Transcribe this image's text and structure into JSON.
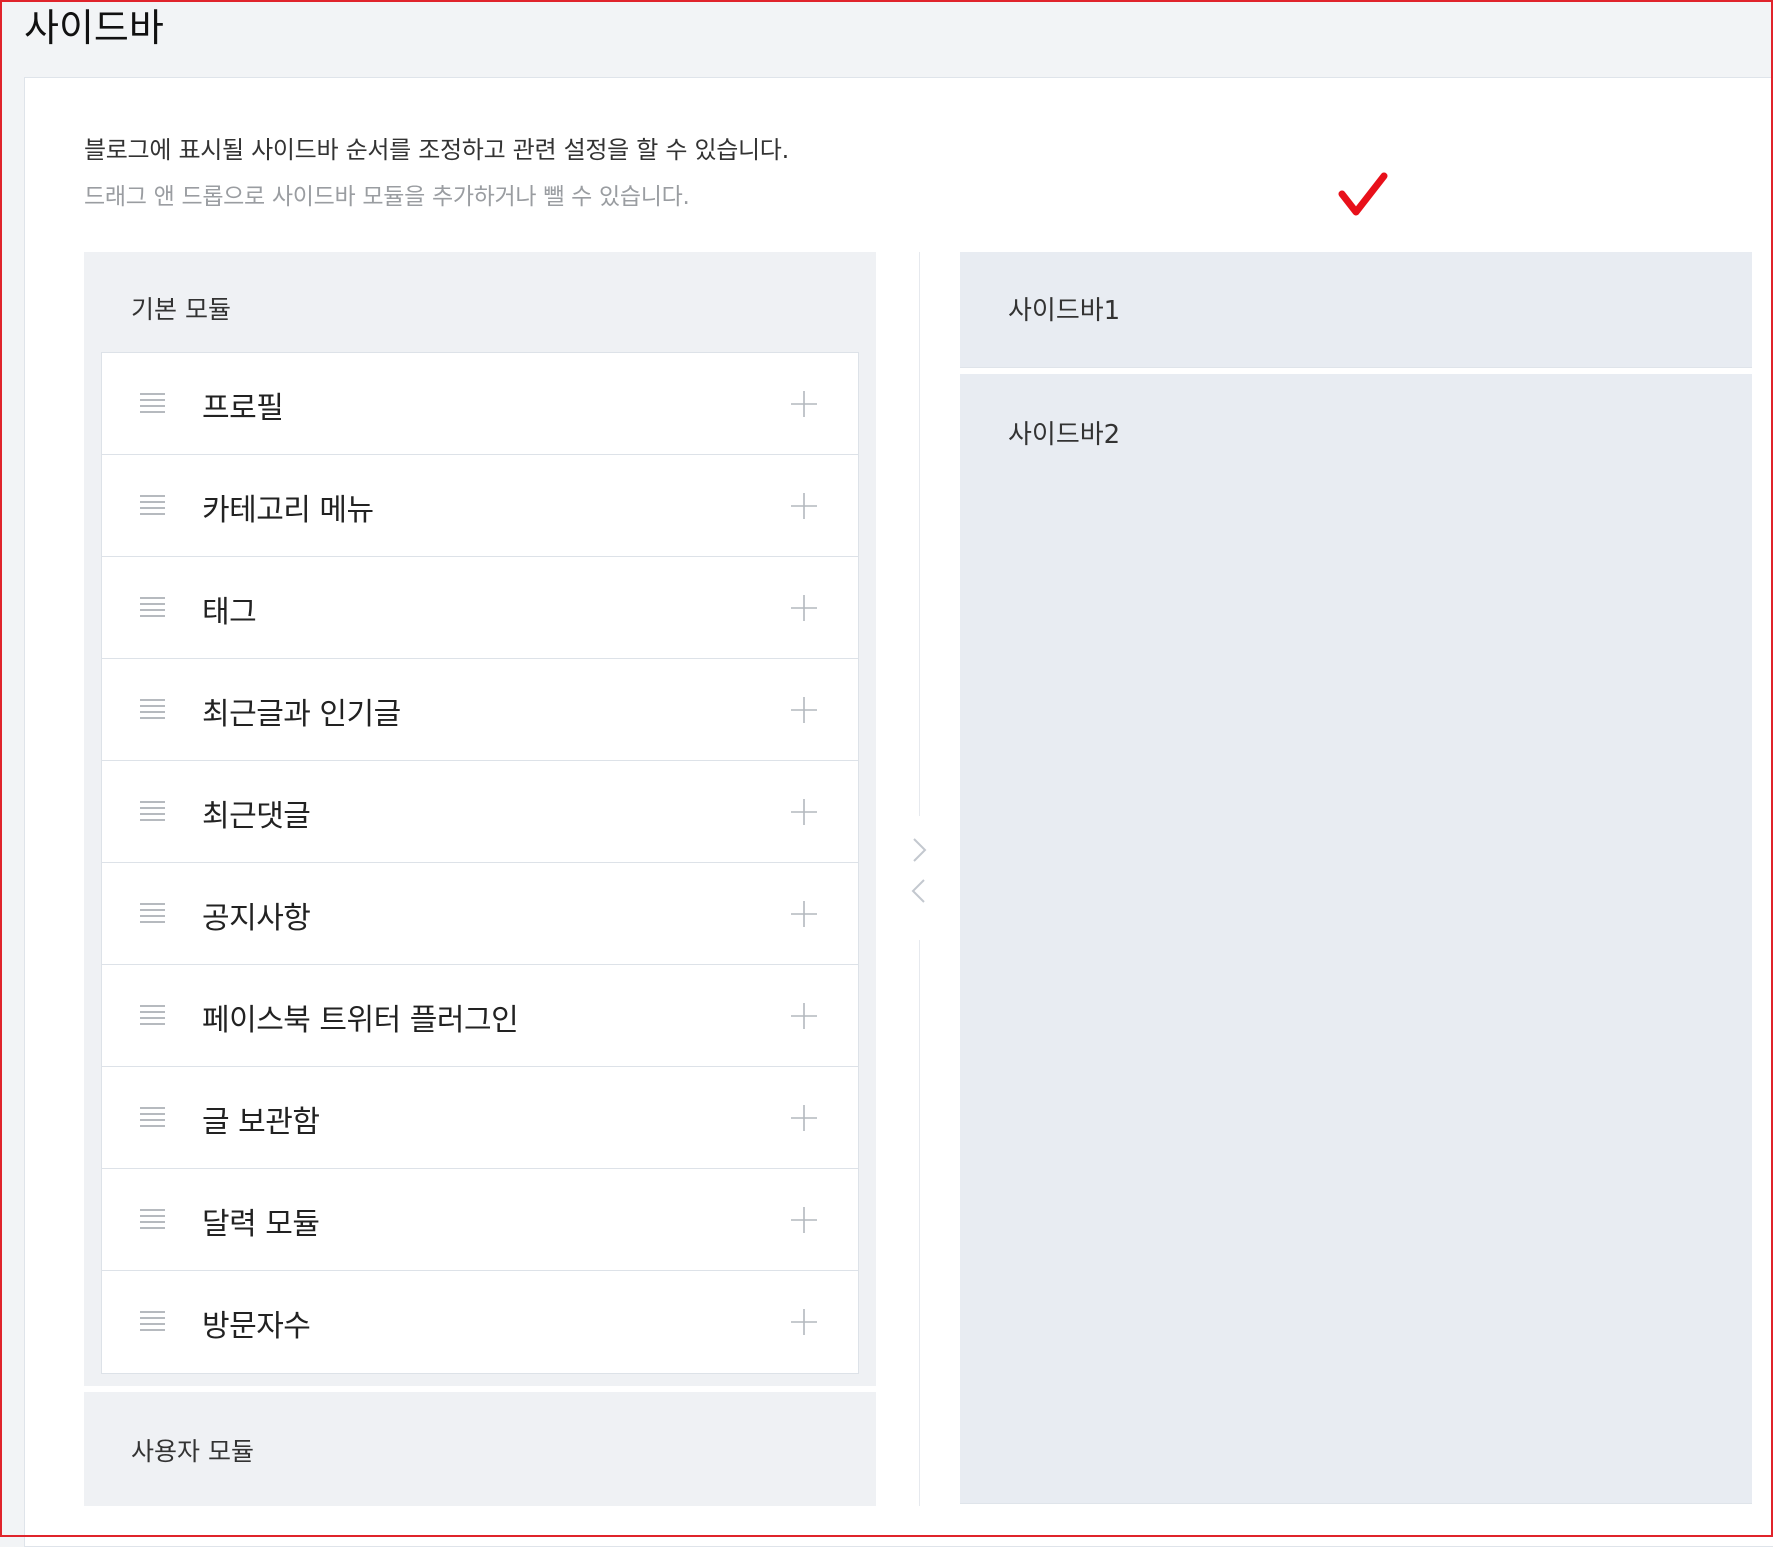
{
  "page": {
    "title": "사이드바",
    "description": "블로그에 표시될 사이드바 순서를 조정하고 관련 설정을 할 수 있습니다.",
    "hint": "드래그 앤 드롭으로 사이드바 모듈을 추가하거나 뺄 수 있습니다."
  },
  "annotation": {
    "icon": "checkmark-icon",
    "color": "#e8101a"
  },
  "basic_modules": {
    "title": "기본 모듈",
    "items": [
      {
        "label": "프로필"
      },
      {
        "label": "카테고리 메뉴"
      },
      {
        "label": "태그"
      },
      {
        "label": "최근글과 인기글"
      },
      {
        "label": "최근댓글"
      },
      {
        "label": "공지사항"
      },
      {
        "label": "페이스북 트위터 플러그인"
      },
      {
        "label": "글 보관함"
      },
      {
        "label": "달력 모듈"
      },
      {
        "label": "방문자수"
      }
    ]
  },
  "user_modules": {
    "title": "사용자 모듈"
  },
  "transfer": {
    "add_icon": "chevron-right-icon",
    "remove_icon": "chevron-left-icon"
  },
  "sidebars": [
    {
      "title": "사이드바1"
    },
    {
      "title": "사이드바2"
    }
  ],
  "colors": {
    "frame_border": "#e0242b",
    "group_bg": "#eff1f4",
    "sidebar_bg": "#e8ecf2"
  }
}
